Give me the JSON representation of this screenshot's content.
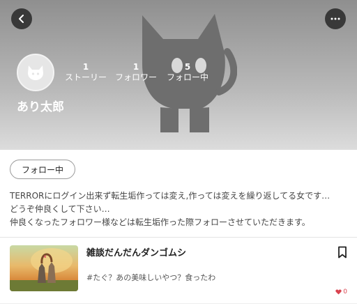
{
  "header": {
    "back_icon": "chevron-left-icon",
    "more_icon": "more-horizontal-icon"
  },
  "profile": {
    "username": "あり太郎",
    "avatar_icon": "cat-avatar-icon",
    "stats": {
      "stories": {
        "count": "1",
        "label": "ストーリー"
      },
      "followers": {
        "count": "1",
        "label": "フォロワー"
      },
      "following": {
        "count": "5",
        "label": "フォロー中"
      }
    },
    "follow_button_label": "フォロー中",
    "bio": [
      "TERRORにログイン出来ず転生垢作っては変え,作っては変えを繰り返してる女です…",
      "どうぞ仲良くして下さい…",
      "仲良くなったフォロワー様などは転生垢作った際フォローさせていただきます。"
    ]
  },
  "stories": [
    {
      "title": "雑談だんだんダンゴムシ",
      "tags": "#たぐ？あの美味しいやつ？食ったわ",
      "likes": "0",
      "bookmark_icon": "bookmark-icon",
      "like_icon": "heart-icon"
    }
  ],
  "colors": {
    "like": "#d9434f",
    "button_dark": "#282828"
  }
}
